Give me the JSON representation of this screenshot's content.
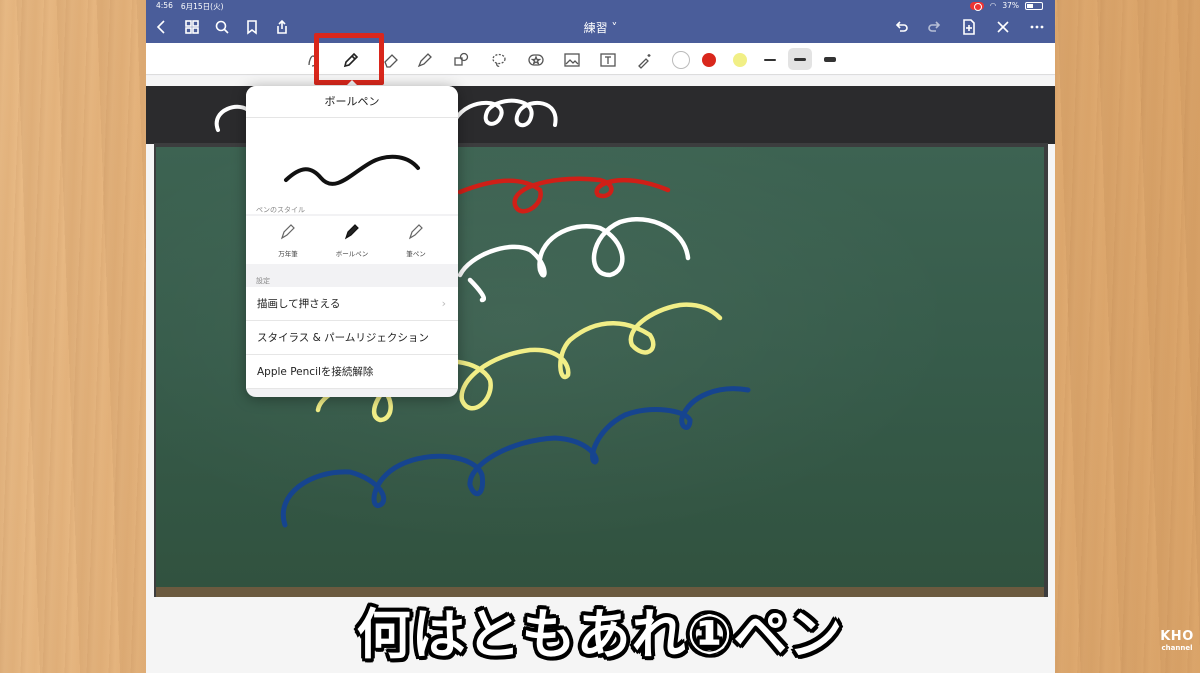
{
  "status_bar": {
    "time": "4:56",
    "date": "6月15日(火)",
    "battery": "37%"
  },
  "nav": {
    "title": "練習 ˅"
  },
  "toolbar": {
    "colors": [
      "#ffffff",
      "#d9271c",
      "#f1ef86"
    ],
    "selected_tool": "pen-icon"
  },
  "popover": {
    "title": "ボールペン",
    "pen_style_label": "ペンのスタイル",
    "styles": [
      {
        "label": "万年筆"
      },
      {
        "label": "ボールペン"
      },
      {
        "label": "筆ペン"
      }
    ],
    "settings_label": "設定",
    "settings": [
      {
        "label": "描画して押さえる"
      },
      {
        "label": "スタイラス & パームリジェクション"
      },
      {
        "label": "Apple Pencilを接続解除"
      }
    ]
  },
  "caption": "何はともあれ①ペン",
  "logo": {
    "line1": "KHO",
    "line2": "channel"
  }
}
